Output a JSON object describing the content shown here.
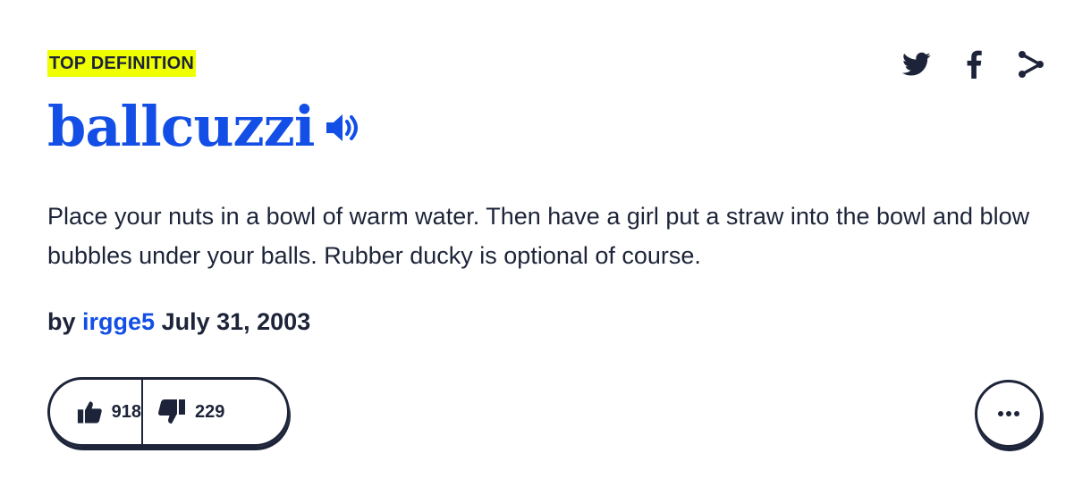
{
  "badge": "TOP DEFINITION",
  "word": "ballcuzzi",
  "meaning": "Place your nuts in a bowl of warm water. Then have a girl put a straw into the bowl and blow bubbles under your balls. Rubber ducky is optional of course.",
  "contributor": {
    "by": "by",
    "author": "irgge5",
    "date": "July 31, 2003"
  },
  "votes": {
    "up": "918",
    "down": "229"
  },
  "icons": {
    "share": [
      "twitter-icon",
      "facebook-icon",
      "share-icon"
    ],
    "speaker": "speaker-icon",
    "thumbs_up": "thumbs-up-icon",
    "thumbs_down": "thumbs-down-icon",
    "more": "ellipsis-icon"
  },
  "colors": {
    "accent": "#134fe6",
    "badge_bg": "#efff00",
    "text": "#1d2439"
  }
}
